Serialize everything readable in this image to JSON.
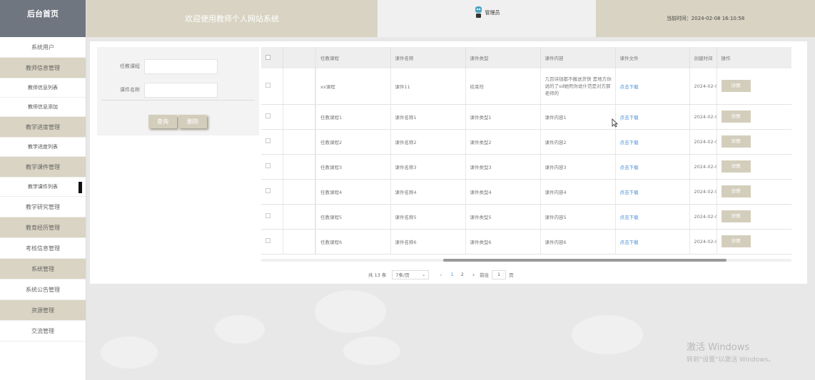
{
  "sidebar": {
    "brand": "后台首页",
    "items": [
      {
        "label": "系统用户",
        "type": "plain"
      },
      {
        "label": "教师信息管理",
        "type": "group"
      },
      {
        "label": "教师信息列表",
        "type": "sub"
      },
      {
        "label": "教师信息添加",
        "type": "sub"
      },
      {
        "label": "教学进度管理",
        "type": "group"
      },
      {
        "label": "教学进度列表",
        "type": "sub"
      },
      {
        "label": "教学课件管理",
        "type": "group"
      },
      {
        "label": "教学课件列表",
        "type": "sub",
        "active": true
      },
      {
        "label": "教学研究管理",
        "type": "plain"
      },
      {
        "label": "教育经历管理",
        "type": "group"
      },
      {
        "label": "考核信息管理",
        "type": "plain"
      },
      {
        "label": "系统管理",
        "type": "group"
      },
      {
        "label": "系统公告管理",
        "type": "plain"
      },
      {
        "label": "资源管理",
        "type": "group"
      },
      {
        "label": "交流管理",
        "type": "plain"
      }
    ]
  },
  "header": {
    "title": "欢迎使用教师个人网站系统",
    "user": "管理员",
    "time": "当前时间：2024-02-08 16:10:58"
  },
  "search": {
    "course_label": "任教课程",
    "course_value": "",
    "name_label": "课件名称",
    "name_value": "",
    "query_button": "查询",
    "delete_button": "删除"
  },
  "table": {
    "headers": [
      "任教课程",
      "课件名称",
      "课件类型",
      "课件内容",
      "课件文件",
      "创建时间",
      "操作"
    ],
    "rows": [
      {
        "course": "xx课程",
        "name": "课件11",
        "type": "结束符",
        "content": "几百块钱都不搬送货快 是地方你说的了sd她死你说什范是对方那老师的",
        "file": "点击下载",
        "created": "2024-02-0",
        "action": "详情"
      },
      {
        "course": "任教课程1",
        "name": "课件名称1",
        "type": "课件类型1",
        "content": "课件内容1",
        "file": "点击下载",
        "created": "2024-02-0",
        "action": "详情"
      },
      {
        "course": "任教课程2",
        "name": "课件名称2",
        "type": "课件类型2",
        "content": "课件内容2",
        "file": "点击下载",
        "created": "2024-02-0",
        "action": "详情"
      },
      {
        "course": "任教课程3",
        "name": "课件名称3",
        "type": "课件类型3",
        "content": "课件内容3",
        "file": "点击下载",
        "created": "2024-02-0",
        "action": "详情"
      },
      {
        "course": "任教课程4",
        "name": "课件名称4",
        "type": "课件类型4",
        "content": "课件内容4",
        "file": "点击下载",
        "created": "2024-02-0",
        "action": "详情"
      },
      {
        "course": "任教课程5",
        "name": "课件名称5",
        "type": "课件类型5",
        "content": "课件内容5",
        "file": "点击下载",
        "created": "2024-02-0",
        "action": "详情"
      },
      {
        "course": "任教课程6",
        "name": "课件名称6",
        "type": "课件类型6",
        "content": "课件内容6",
        "file": "点击下载",
        "created": "2024-02-0",
        "action": "详情"
      }
    ]
  },
  "pagination": {
    "total": "共 13 条",
    "page_size": "7条/页",
    "pages": [
      "1",
      "2"
    ],
    "current": "1",
    "goto_label": "前往",
    "goto_value": "1",
    "page_suffix": "页"
  },
  "watermark": {
    "line1": "激活 Windows",
    "line2": "转到\"设置\"以激活 Windows。"
  },
  "colors": {
    "accent": "#d9d4c3",
    "brand_bg": "#6f7680",
    "link": "#4a8fd6"
  }
}
